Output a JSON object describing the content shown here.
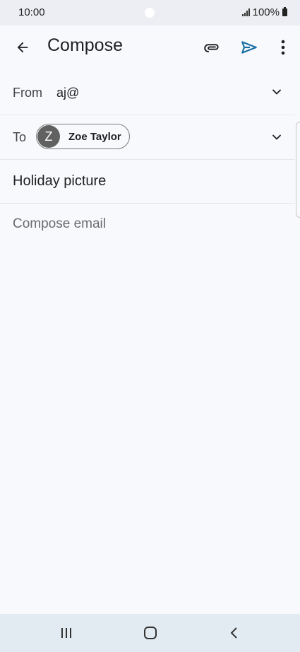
{
  "status_bar": {
    "time": "10:00",
    "battery": "100%"
  },
  "app_bar": {
    "title": "Compose",
    "icons": {
      "back": "arrow-left-icon",
      "attach": "paperclip-icon",
      "send": "send-icon",
      "more": "more-vert-icon"
    },
    "send_color": "#1a6fa3"
  },
  "from": {
    "label": "From",
    "value": "aj@"
  },
  "to": {
    "label": "To",
    "recipient": {
      "initial": "Z",
      "name": "Zoe Taylor"
    }
  },
  "subject": {
    "value": "Holiday picture"
  },
  "body": {
    "placeholder": "Compose email"
  },
  "nav_bar": {
    "icons": [
      "recents-icon",
      "home-icon",
      "back-nav-icon"
    ]
  }
}
